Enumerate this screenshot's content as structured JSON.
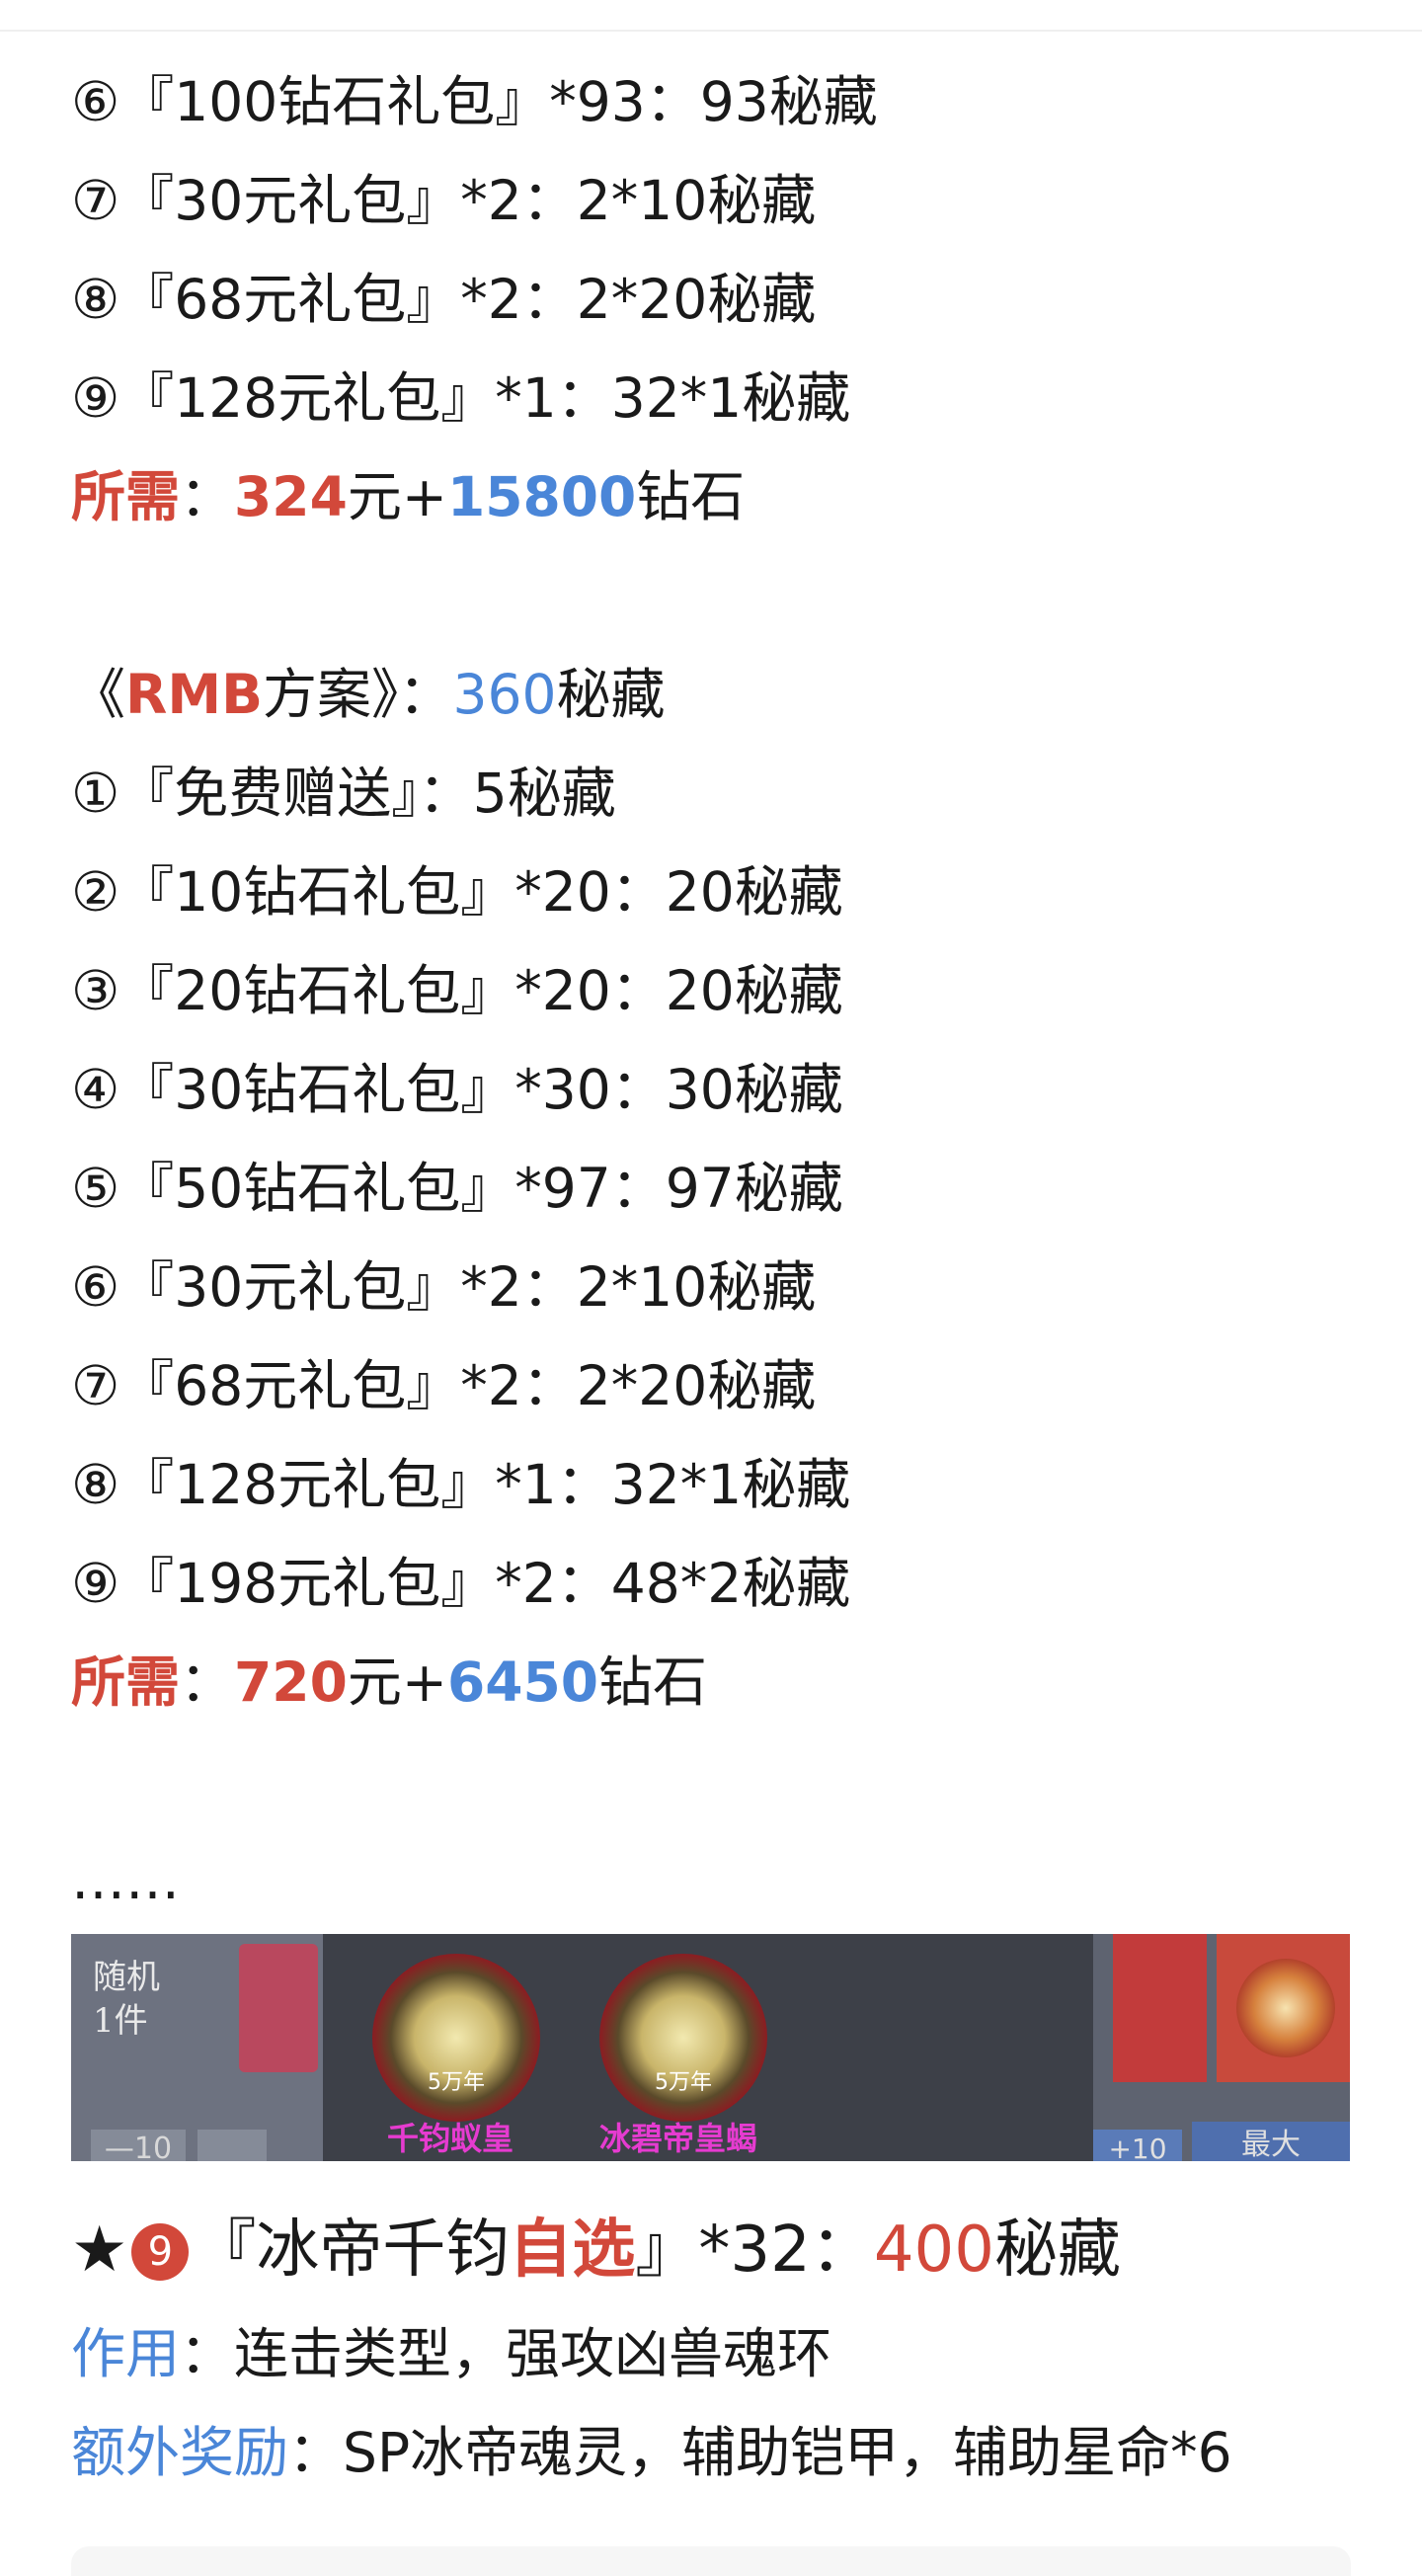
{
  "plan1": {
    "items": [
      "⑥『100钻石礼包』*93：93秘藏",
      "⑦『30元礼包』*2：2*10秘藏",
      "⑧『68元礼包』*2：2*20秘藏",
      "⑨『128元礼包』*1：32*1秘藏"
    ],
    "required_label": "所需",
    "required_sep": "：",
    "rmb": "324",
    "yuan_plus": "元+",
    "diamonds": "15800",
    "diamond_unit": "钻石"
  },
  "plan2": {
    "open": "《",
    "rmb_label": "RMB",
    "title_rest": "方案》：",
    "count": "360",
    "count_unit": "秘藏",
    "items": [
      "①『免费赠送』：5秘藏",
      "②『10钻石礼包』*20：20秘藏",
      "③『20钻石礼包』*20：20秘藏",
      "④『30钻石礼包』*30：30秘藏",
      "⑤『50钻石礼包』*97：97秘藏",
      "⑥『30元礼包』*2：2*10秘藏",
      "⑦『68元礼包』*2：2*20秘藏",
      "⑧『128元礼包』*1：32*1秘藏",
      "⑨『198元礼包』*2：48*2秘藏"
    ],
    "required_label": "所需",
    "required_sep": "：",
    "rmb": "720",
    "yuan_plus": "元+",
    "diamonds": "6450",
    "diamond_unit": "钻石"
  },
  "ellipsis": "……",
  "banner": {
    "tag_line1": "随机",
    "tag_line2": "1件",
    "left_btn": "—10",
    "orb1_age": "5万年",
    "orb1_name": "千钧蚁皇",
    "orb2_age": "5万年",
    "orb2_name": "冰碧帝皇蝎",
    "right_btn": "+10",
    "max_btn": "最大"
  },
  "feature": {
    "star": "★",
    "badge": "9",
    "open": "『冰帝千钧",
    "highlight": "自选",
    "close": "』*32：",
    "count": "400",
    "count_unit": "秘藏",
    "effect_label": "作用",
    "effect_sep": "：",
    "effect_text": "连击类型，强攻凶兽魂环",
    "bonus_label": "额外奖励",
    "bonus_sep": "：",
    "bonus_text": "SP冰帝魂灵，辅助铠甲，辅助星命*6"
  }
}
